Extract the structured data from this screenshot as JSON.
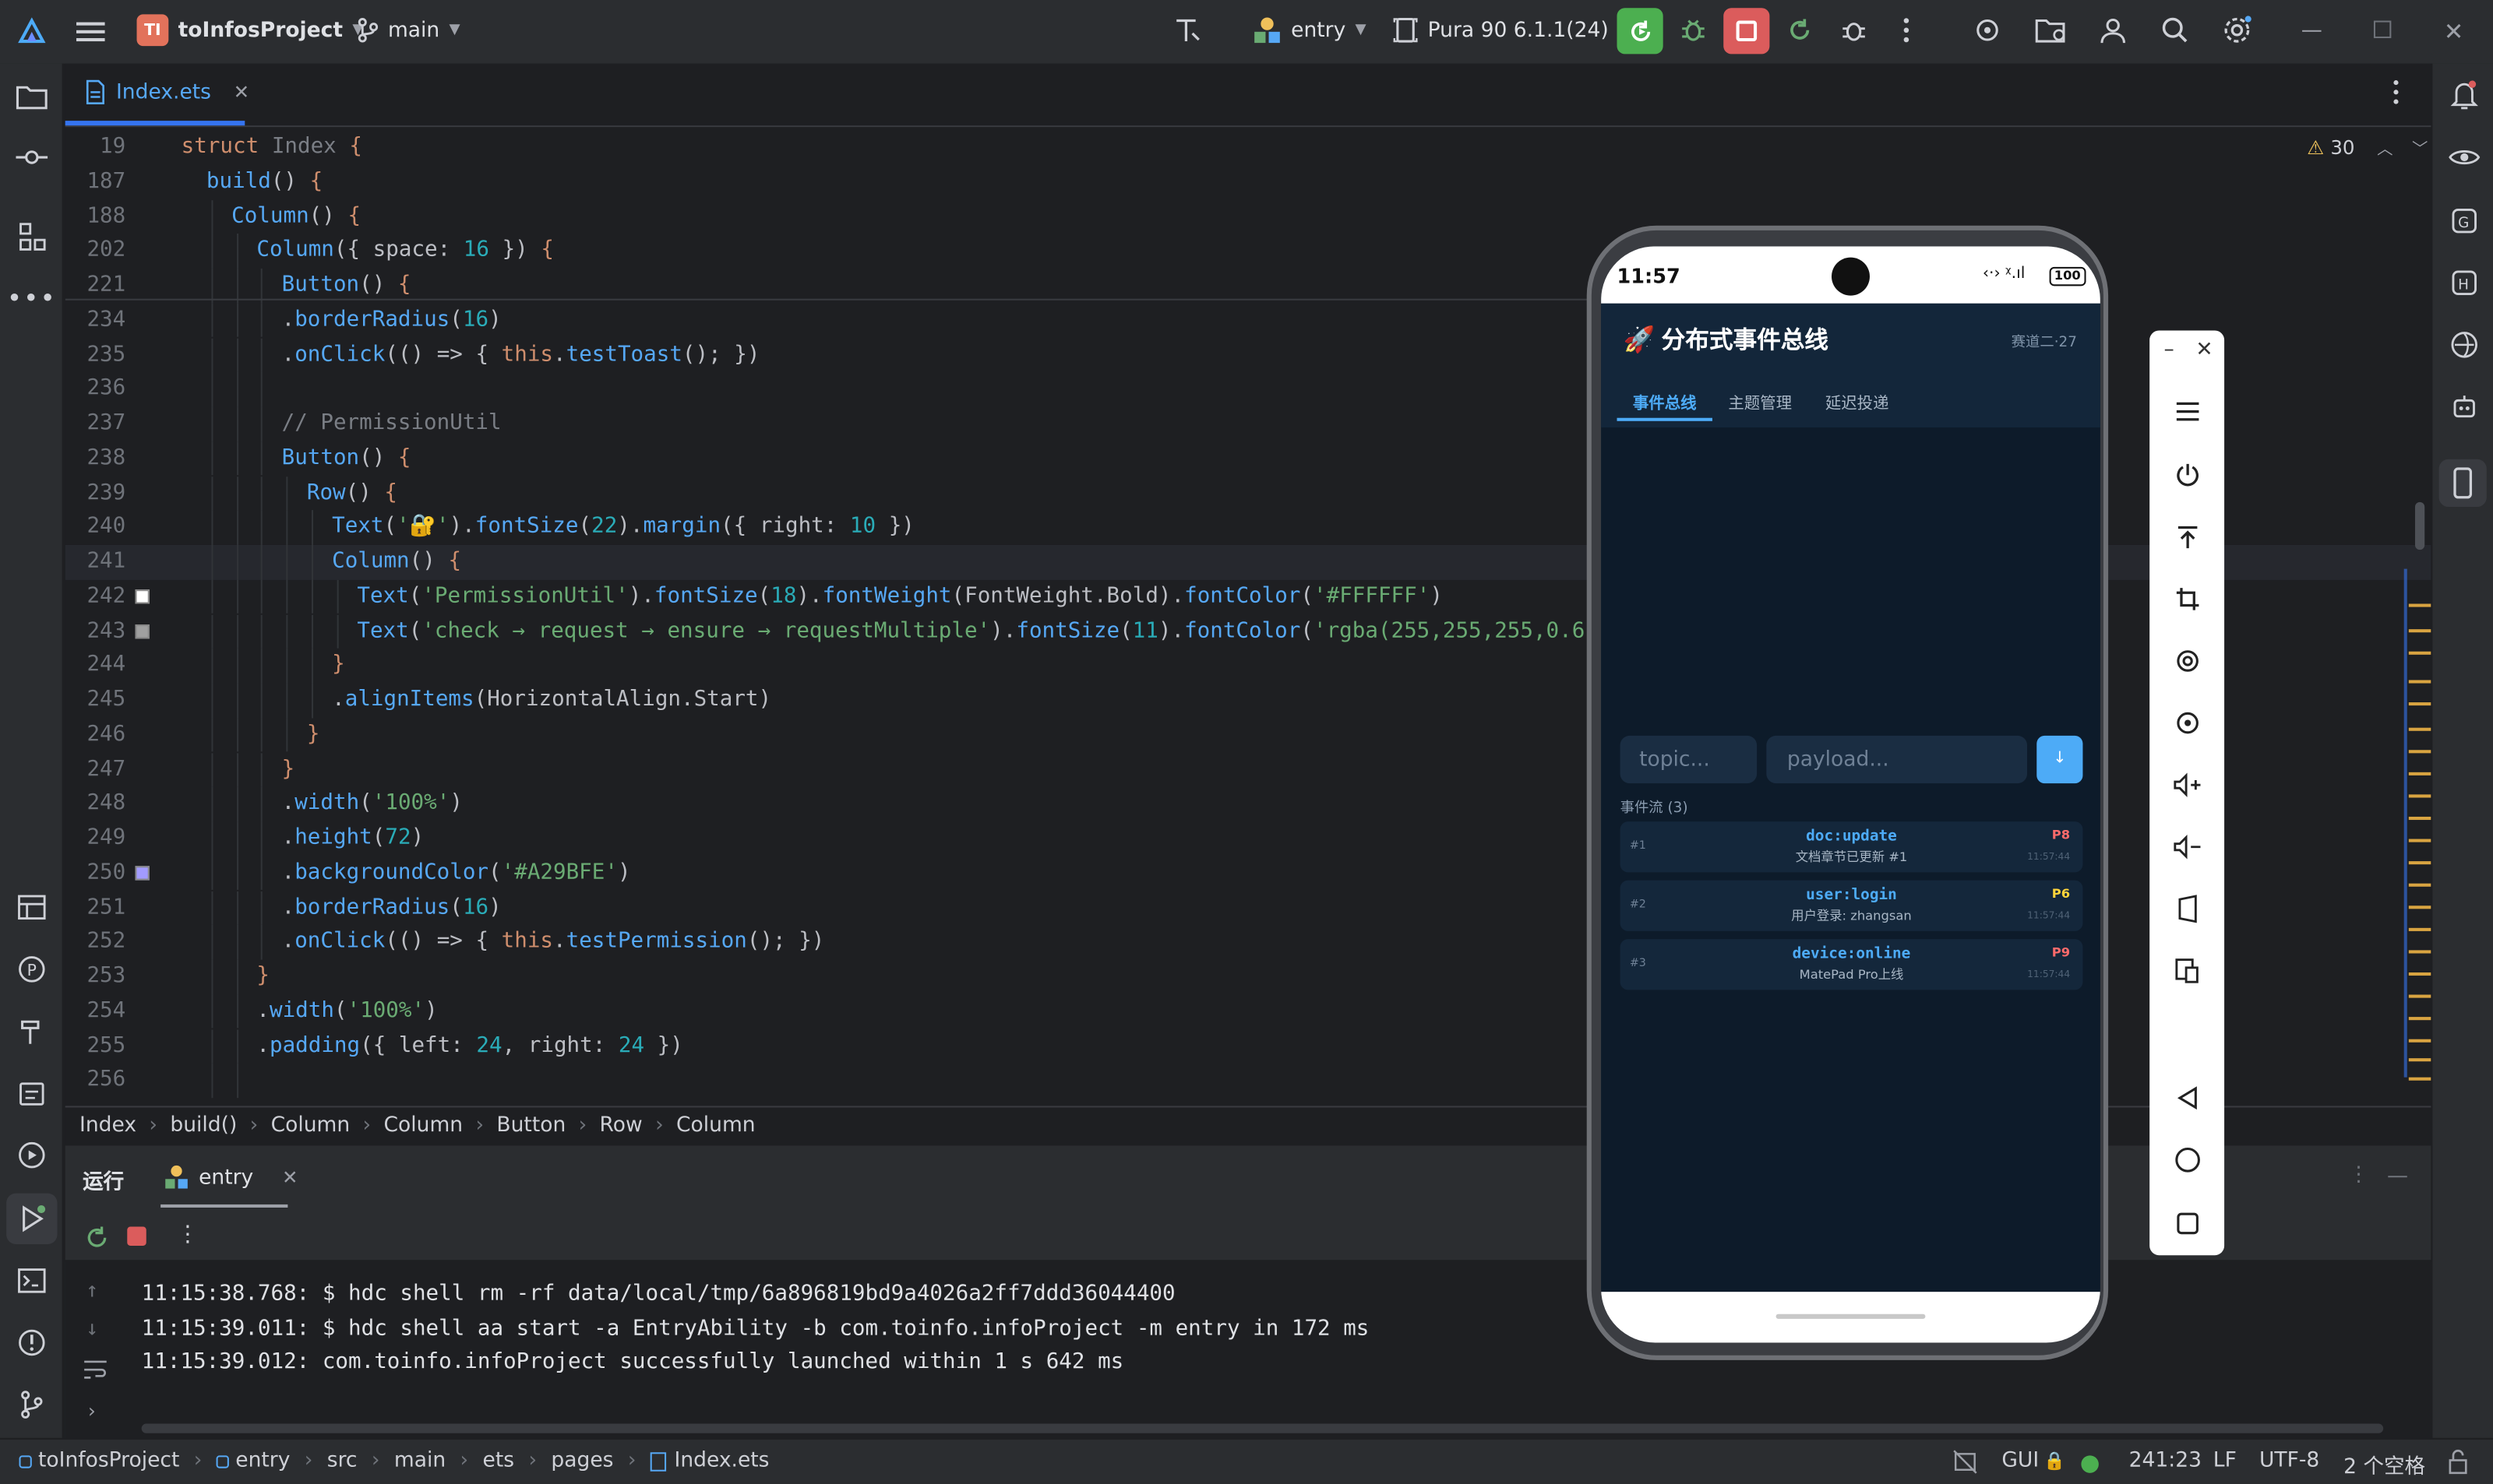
{
  "titlebar": {
    "project_badge": "TI",
    "project_name": "toInfosProject",
    "branch": "main",
    "run_config": "entry",
    "device": "Pura 90 6.1.1(24)"
  },
  "editor": {
    "tab_label": "Index.ets",
    "warning_count": "30",
    "lines": [
      {
        "num": "19",
        "html": "<span class=\"k\">struct</span> <span class=\"ty\" style=\"color:#7a7e85\">Index</span> <span class=\"k\">{</span>",
        "indent": 0
      },
      {
        "num": "187",
        "html": "<span class=\"f\">build</span>() <span class=\"k\">{</span>",
        "indent": 1
      },
      {
        "num": "188",
        "html": "<span class=\"f\">Column</span>() <span class=\"k\">{</span>",
        "indent": 2
      },
      {
        "num": "202",
        "html": "<span class=\"f\">Column</span>({ space: <span class=\"n\">16</span> }) <span class=\"k\">{</span>",
        "indent": 3
      },
      {
        "num": "221",
        "html": "<span class=\"f\">Button</span>() <span class=\"k\">{</span>",
        "indent": 4
      },
      {
        "num": "234",
        "html": ".<span class=\"f\">borderRadius</span>(<span class=\"n\">16</span>)",
        "indent": 4
      },
      {
        "num": "235",
        "html": ".<span class=\"f\">onClick</span>(() => { <span class=\"k\">this</span>.<span class=\"f\">testToast</span>(); })",
        "indent": 4
      },
      {
        "num": "236",
        "html": "",
        "indent": 4
      },
      {
        "num": "237",
        "html": "<span class=\"c\">// PermissionUtil</span>",
        "indent": 4
      },
      {
        "num": "238",
        "html": "<span class=\"f\">Button</span>() <span class=\"k\">{</span>",
        "indent": 4
      },
      {
        "num": "239",
        "html": "<span class=\"f\">Row</span>() <span class=\"k\">{</span>",
        "indent": 5
      },
      {
        "num": "240",
        "html": "<span class=\"f\">Text</span>(<span class=\"s\">'🔐'</span>).<span class=\"f\">fontSize</span>(<span class=\"n\">22</span>).<span class=\"f\">margin</span>({ right: <span class=\"n\">10</span> })",
        "indent": 6
      },
      {
        "num": "241",
        "html": "<span class=\"f\">Column</span>() <span class=\"k\">{</span>",
        "indent": 6
      },
      {
        "num": "242",
        "html": "<span class=\"f\">Text</span>(<span class=\"s\">'PermissionUtil'</span>).<span class=\"f\">fontSize</span>(<span class=\"n\">18</span>).<span class=\"f\">fontWeight</span>(FontWeight.Bold).<span class=\"f\">fontColor</span>(<span class=\"s\">'#FFFFFF'</span>)",
        "indent": 7
      },
      {
        "num": "243",
        "html": "<span class=\"f\">Text</span>(<span class=\"s\">'check → request → ensure → requestMultiple'</span>).<span class=\"f\">fontSize</span>(<span class=\"n\">11</span>).<span class=\"f\">fontColor</span>(<span class=\"s\">'rgba(255,255,255,0.6)'</span>)",
        "indent": 7
      },
      {
        "num": "244",
        "html": "<span class=\"k\">}</span>",
        "indent": 6
      },
      {
        "num": "245",
        "html": ".<span class=\"f\">alignItems</span>(HorizontalAlign.Start)",
        "indent": 6
      },
      {
        "num": "246",
        "html": "<span class=\"k\">}</span>",
        "indent": 5
      },
      {
        "num": "247",
        "html": "<span class=\"k\">}</span>",
        "indent": 4
      },
      {
        "num": "248",
        "html": ".<span class=\"f\">width</span>(<span class=\"s\">'100%'</span>)",
        "indent": 4
      },
      {
        "num": "249",
        "html": ".<span class=\"f\">height</span>(<span class=\"n\">72</span>)",
        "indent": 4
      },
      {
        "num": "250",
        "html": ".<span class=\"f\">backgroundColor</span>(<span class=\"s\">'#A29BFE'</span>)",
        "indent": 4
      },
      {
        "num": "251",
        "html": ".<span class=\"f\">borderRadius</span>(<span class=\"n\">16</span>)",
        "indent": 4
      },
      {
        "num": "252",
        "html": ".<span class=\"f\">onClick</span>(() => { <span class=\"k\">this</span>.<span class=\"f\">testPermission</span>(); })",
        "indent": 4
      },
      {
        "num": "253",
        "html": "<span class=\"k\">}</span>",
        "indent": 3
      },
      {
        "num": "254",
        "html": ".<span class=\"f\">width</span>(<span class=\"s\">'100%'</span>)",
        "indent": 3
      },
      {
        "num": "255",
        "html": ".<span class=\"f\">padding</span>({ left: <span class=\"n\">24</span>, right: <span class=\"n\">24</span> })",
        "indent": 3
      },
      {
        "num": "256",
        "html": "",
        "indent": 3
      }
    ]
  },
  "breadcrumb": [
    "Index",
    "build()",
    "Column",
    "Column",
    "Button",
    "Row",
    "Column"
  ],
  "run": {
    "tab_run": "运行",
    "tab_entry": "entry",
    "console": [
      "11:15:38.768: $ hdc shell rm -rf data/local/tmp/6a896819bd9a4026a2ff7ddd36044400",
      "11:15:39.011: $ hdc shell aa start -a EntryAbility -b com.toinfo.infoProject -m entry in 172 ms",
      "11:15:39.012: com.toinfo.infoProject successfully launched within 1 s 642 ms"
    ]
  },
  "statusbar": {
    "path": [
      "toInfosProject",
      "entry",
      "src",
      "main",
      "ets",
      "pages",
      "Index.ets"
    ],
    "gui": "GUI",
    "position": "241:23",
    "line_sep": "LF",
    "encoding": "UTF-8",
    "indent": "2 个空格"
  },
  "phone": {
    "time": "11:57",
    "battery": "100",
    "app_title": "分布式事件总线",
    "app_subtitle": "赛道二·27",
    "tabs": [
      "事件总线",
      "主题管理",
      "延迟投递"
    ],
    "topic_placeholder": "topic...",
    "payload_placeholder": "payload...",
    "send_label": "↓",
    "events_header": "事件流 (3)",
    "events": [
      {
        "idx": "#1",
        "topic": "doc:update",
        "desc": "文档章节已更新 #1",
        "priority": "P8",
        "time": "11:57:44"
      },
      {
        "idx": "#2",
        "topic": "user:login",
        "desc": "用户登录: zhangsan",
        "priority": "P6",
        "time": "11:57:44"
      },
      {
        "idx": "#3",
        "topic": "device:online",
        "desc": "MatePad Pro上线",
        "priority": "P9",
        "time": "11:57:44"
      }
    ]
  },
  "colors": {
    "run_green": "#4caf50",
    "stop_red": "#db5c5c",
    "accent_blue": "#4dabf7",
    "priority_red": "#ff6b6b",
    "priority_yellow": "#ffd43b",
    "swatch_white": "#FFFFFF",
    "swatch_gray": "#a0a0a0",
    "swatch_purple": "#A29BFE"
  }
}
